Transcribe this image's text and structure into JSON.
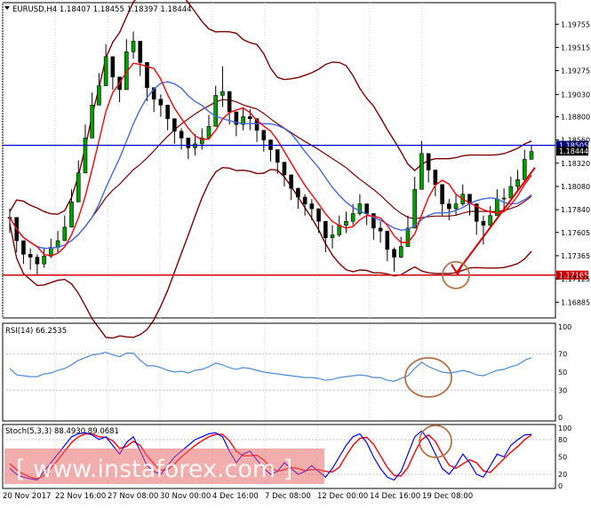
{
  "header": {
    "symbol_info": "EURUSD,H4  1.18407 1.18455 1.18397 1.18444"
  },
  "colors": {
    "background": "#ffffff",
    "grid": "#c8c8c8",
    "frame": "#000000",
    "candle": "#000000",
    "bull_candle": "#00a000",
    "bollinger": "#800000",
    "fast_ma": "#ff0000",
    "slow_ma": "#4169e1",
    "resistance_line": "#0000cc",
    "support_line": "#cc0000",
    "forecast_arrow": "#dd0000",
    "annotation_circle": "#b5734a",
    "rsi_line": "#4a8bdc",
    "stoch_main": "#0000ff",
    "stoch_signal": "#ff0000",
    "watermark": "#e86a6a",
    "price_tag_red": "#cc0000",
    "price_tag_blue": "#000080"
  },
  "price_axis": {
    "ticks": [
      "1.19755",
      "1.19515",
      "1.19275",
      "1.19030",
      "1.18800",
      "1.18560",
      "1.18320",
      "1.18080",
      "1.17840",
      "1.17605",
      "1.17365",
      "1.17125",
      "1.16885"
    ]
  },
  "levels": {
    "resistance": {
      "value": 1.18505,
      "label": "1.18505"
    },
    "current": {
      "value": 1.18444,
      "label": "1.18444"
    },
    "support": {
      "value": 1.17165,
      "label": "1.17165"
    }
  },
  "rsi": {
    "title": "RSI(14) 66.2535",
    "ticks": [
      "100",
      "70",
      "50",
      "30",
      "0"
    ]
  },
  "stoch": {
    "title": "Stoch(5,3,3) 88.4930 89.0681",
    "ticks": [
      "100",
      "80",
      "50",
      "20",
      "0"
    ]
  },
  "time_axis": {
    "labels": [
      "20 Nov 2017",
      "22 Nov 16:00",
      "27 Nov 08:00",
      "30 Nov 00:00",
      "4 Dec 16:00",
      "7 Dec 08:00",
      "12 Dec 00:00",
      "14 Dec 16:00",
      "19 Dec 08:00"
    ]
  },
  "watermark": {
    "text": "[ www.instaforex.com ]"
  },
  "chart_data": {
    "type": "line",
    "title": "EURUSD,H4",
    "y_range": [
      1.1675,
      1.1995
    ],
    "x_categories": [
      "20 Nov 2017",
      "22 Nov 16:00",
      "27 Nov 08:00",
      "30 Nov 00:00",
      "4 Dec 16:00",
      "7 Dec 08:00",
      "12 Dec 00:00",
      "14 Dec 16:00",
      "19 Dec 08:00"
    ],
    "close": [
      1.1776,
      1.1752,
      1.1738,
      1.1735,
      1.1728,
      1.1736,
      1.1745,
      1.1752,
      1.1766,
      1.1792,
      1.1822,
      1.1858,
      1.1892,
      1.1912,
      1.1942,
      1.1921,
      1.1908,
      1.1947,
      1.1958,
      1.1936,
      1.191,
      1.1898,
      1.1892,
      1.1878,
      1.1865,
      1.1858,
      1.1848,
      1.1852,
      1.1858,
      1.187,
      1.1902,
      1.1906,
      1.1885,
      1.1872,
      1.188,
      1.1878,
      1.1866,
      1.1856,
      1.1846,
      1.1833,
      1.182,
      1.1806,
      1.1797,
      1.179,
      1.1785,
      1.1772,
      1.1755,
      1.1758,
      1.1768,
      1.1772,
      1.178,
      1.179,
      1.178,
      1.1765,
      1.1762,
      1.1743,
      1.1735,
      1.1746,
      1.1765,
      1.1805,
      1.1842,
      1.1825,
      1.181,
      1.179,
      1.1785,
      1.179,
      1.18,
      1.179,
      1.1772,
      1.1768,
      1.1778,
      1.1795,
      1.1796,
      1.1808,
      1.1815,
      1.1836,
      1.1844
    ],
    "high": [
      1.1785,
      1.1762,
      1.175,
      1.1744,
      1.1738,
      1.1745,
      1.1754,
      1.1762,
      1.1778,
      1.1805,
      1.1835,
      1.1872,
      1.1905,
      1.1925,
      1.1955,
      1.1935,
      1.192,
      1.196,
      1.1968,
      1.1948,
      1.1922,
      1.1908,
      1.1903,
      1.189,
      1.1876,
      1.1868,
      1.1858,
      1.1862,
      1.1868,
      1.1882,
      1.1912,
      1.1932,
      1.1898,
      1.1885,
      1.189,
      1.1888,
      1.1876,
      1.1866,
      1.1856,
      1.1843,
      1.183,
      1.1816,
      1.1807,
      1.18,
      1.1795,
      1.1782,
      1.1765,
      1.1768,
      1.1778,
      1.1782,
      1.179,
      1.18,
      1.179,
      1.1775,
      1.1772,
      1.1753,
      1.1745,
      1.1756,
      1.1778,
      1.1818,
      1.1855,
      1.1838,
      1.182,
      1.18,
      1.1795,
      1.18,
      1.181,
      1.18,
      1.1782,
      1.1778,
      1.1788,
      1.1805,
      1.1806,
      1.1818,
      1.1825,
      1.1846,
      1.185
    ],
    "low": [
      1.176,
      1.174,
      1.1728,
      1.1722,
      1.1716,
      1.1724,
      1.1734,
      1.174,
      1.1752,
      1.1778,
      1.1808,
      1.184,
      1.1876,
      1.1896,
      1.1924,
      1.1908,
      1.1895,
      1.1928,
      1.194,
      1.1922,
      1.1896,
      1.1885,
      1.188,
      1.1866,
      1.1852,
      1.1846,
      1.1836,
      1.184,
      1.1846,
      1.1856,
      1.1888,
      1.189,
      1.1872,
      1.186,
      1.1866,
      1.1866,
      1.1854,
      1.1844,
      1.1834,
      1.1821,
      1.1808,
      1.1794,
      1.1785,
      1.1778,
      1.1773,
      1.176,
      1.174,
      1.1744,
      1.1756,
      1.176,
      1.1768,
      1.1778,
      1.1768,
      1.1753,
      1.175,
      1.1731,
      1.172,
      1.1734,
      1.1752,
      1.179,
      1.1828,
      1.1812,
      1.1798,
      1.1778,
      1.1773,
      1.1778,
      1.1788,
      1.1778,
      1.1758,
      1.1748,
      1.1766,
      1.1783,
      1.1784,
      1.1796,
      1.1803,
      1.1823,
      1.1838
    ],
    "rsi_values": [
      54,
      47,
      46,
      45,
      45,
      48,
      49,
      52,
      54,
      58,
      63,
      66,
      69,
      70,
      72,
      69,
      67,
      71,
      71,
      63,
      57,
      57,
      55,
      52,
      50,
      51,
      49,
      52,
      53,
      56,
      60,
      58,
      55,
      53,
      55,
      54,
      52,
      50,
      49,
      48,
      47,
      46,
      45,
      44,
      44,
      43,
      41,
      42,
      44,
      45,
      46,
      47,
      46,
      44,
      44,
      41,
      40,
      43,
      46,
      54,
      61,
      56,
      53,
      50,
      49,
      50,
      52,
      50,
      47,
      46,
      49,
      52,
      53,
      56,
      58,
      63,
      66
    ],
    "stoch_main": [
      30,
      20,
      15,
      12,
      10,
      25,
      40,
      55,
      70,
      85,
      90,
      92,
      88,
      80,
      85,
      70,
      55,
      75,
      85,
      60,
      35,
      25,
      20,
      35,
      50,
      60,
      70,
      80,
      85,
      90,
      92,
      85,
      60,
      40,
      55,
      60,
      45,
      30,
      20,
      25,
      40,
      30,
      20,
      25,
      35,
      25,
      15,
      30,
      50,
      70,
      85,
      90,
      75,
      50,
      30,
      15,
      10,
      25,
      55,
      85,
      95,
      80,
      55,
      30,
      20,
      35,
      55,
      40,
      20,
      15,
      35,
      55,
      50,
      70,
      80,
      88,
      89
    ],
    "stoch_signal": [
      38,
      28,
      20,
      15,
      12,
      18,
      30,
      45,
      60,
      75,
      85,
      90,
      90,
      85,
      84,
      78,
      65,
      68,
      77,
      70,
      52,
      38,
      27,
      28,
      38,
      50,
      60,
      70,
      78,
      85,
      89,
      89,
      78,
      60,
      52,
      52,
      53,
      45,
      32,
      25,
      28,
      32,
      30,
      26,
      28,
      28,
      25,
      24,
      32,
      52,
      70,
      82,
      84,
      72,
      52,
      32,
      18,
      17,
      32,
      58,
      80,
      88,
      77,
      55,
      36,
      30,
      38,
      45,
      40,
      26,
      23,
      35,
      47,
      58,
      68,
      80,
      88
    ]
  }
}
